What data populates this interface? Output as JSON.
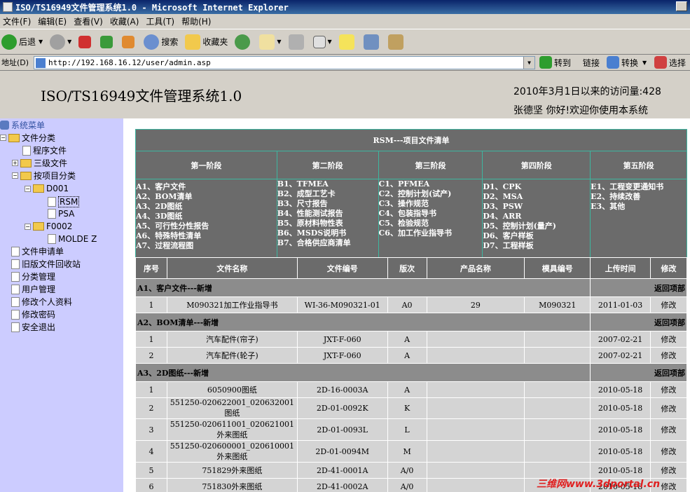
{
  "window": {
    "title": "ISO/TS16949文件管理系统1.0 - Microsoft Internet Explorer"
  },
  "menu": [
    "文件(F)",
    "编辑(E)",
    "查看(V)",
    "收藏(A)",
    "工具(T)",
    "帮助(H)"
  ],
  "toolbar": {
    "back": "后退",
    "search": "搜索",
    "favorites": "收藏夹"
  },
  "address": {
    "label": "地址(D)",
    "url": "http://192.168.16.12/user/admin.asp",
    "go": "转到",
    "links": "链接",
    "convert": "转换",
    "select": "选择"
  },
  "header": {
    "system_title": "ISO/TS16949文件管理系统1.0",
    "visit": "2010年3月1日以来的访问量:428",
    "welcome": "张德坚  你好!欢迎你使用本系统"
  },
  "tree": {
    "root": "系统菜单",
    "file_cat": "文件分类",
    "proc": "程序文件",
    "lvl3": "三级文件",
    "byproj": "按项目分类",
    "d001": "D001",
    "rsm": "RSM",
    "psa": "PSA",
    "f0002": "F0002",
    "molde": "MOLDE Z",
    "apply": "文件申请单",
    "recycle": "旧版文件回收站",
    "catmgr": "分类管理",
    "usermgr": "用户管理",
    "profile": "修改个人资料",
    "pwd": "修改密码",
    "logout": "安全退出"
  },
  "rsm": {
    "title": "RSM---项目文件清单",
    "stages": [
      "第一阶段",
      "第二阶段",
      "第三阶段",
      "第四阶段",
      "第五阶段"
    ],
    "s1": [
      "A1、客户文件",
      "A2、BOM清单",
      "A3、2D图纸",
      "A4、3D图纸",
      "A5、可行性分性报告",
      "A6、特殊特性清单",
      "A7、过程流程图"
    ],
    "s2": [
      "B1、TFMEA",
      "B2、成型工艺卡",
      "B3、尺寸报告",
      "B4、性能测试报告",
      "B5、原材料物性表",
      "B6、MSDS说明书",
      "B7、合格供应商清单"
    ],
    "s3": [
      "C1、PFMEA",
      "C2、控制计划(试产)",
      "C3、操作规范",
      "C4、包装指导书",
      "C5、检验规范",
      "C6、加工作业指导书"
    ],
    "s4": [
      "D1、CPK",
      "D2、MSA",
      "D3、PSW",
      "D4、ARR",
      "D5、控制计划(量产)",
      "D6、客户样板",
      "D7、工程样板"
    ],
    "s5": [
      "E1、工程变更通知书",
      "E2、持续改善",
      "E3、其他"
    ]
  },
  "list": {
    "headers": [
      "序号",
      "文件名称",
      "文件编号",
      "版次",
      "产品名称",
      "模具编号",
      "上传时间",
      "修改"
    ],
    "return": "返回项部",
    "sections": [
      {
        "title": "A1、客户文件---新增",
        "rows": [
          [
            "1",
            "M090321加工作业指导书",
            "WI-36-M090321-01",
            "A0",
            "29",
            "M090321",
            "2011-01-03",
            "修改"
          ]
        ]
      },
      {
        "title": "A2、BOM清单---新增",
        "rows": [
          [
            "1",
            "汽车配件(帘子)",
            "JXT-F-060",
            "A",
            "",
            "",
            "2007-02-21",
            "修改"
          ],
          [
            "2",
            "汽车配件(轮子)",
            "JXT-F-060",
            "A",
            "",
            "",
            "2007-02-21",
            "修改"
          ]
        ]
      },
      {
        "title": "A3、2D图纸---新增",
        "rows": [
          [
            "1",
            "6050900图纸",
            "2D-16-0003A",
            "A",
            "",
            "",
            "2010-05-18",
            "修改"
          ],
          [
            "2",
            "551250-020622001_020632001图纸",
            "2D-01-0092K",
            "K",
            "",
            "",
            "2010-05-18",
            "修改"
          ],
          [
            "3",
            "551250-020611001_020621001外来图纸",
            "2D-01-0093L",
            "L",
            "",
            "",
            "2010-05-18",
            "修改"
          ],
          [
            "4",
            "551250-020600001_020610001外来图纸",
            "2D-01-0094M",
            "M",
            "",
            "",
            "2010-05-18",
            "修改"
          ],
          [
            "5",
            "751829外来图纸",
            "2D-41-0001A",
            "A/0",
            "",
            "",
            "2010-05-18",
            "修改"
          ],
          [
            "6",
            "751830外来图纸",
            "2D-41-0002A",
            "A/0",
            "",
            "",
            "2010-05-18",
            "修改"
          ]
        ]
      }
    ]
  },
  "watermark": "三维网www.3dportal.cn",
  "colors": {
    "sidebar": "#ccccff",
    "header": "#d4d0c8",
    "table_dark": "#6b6b6b",
    "table_border": "#3db6a0"
  }
}
